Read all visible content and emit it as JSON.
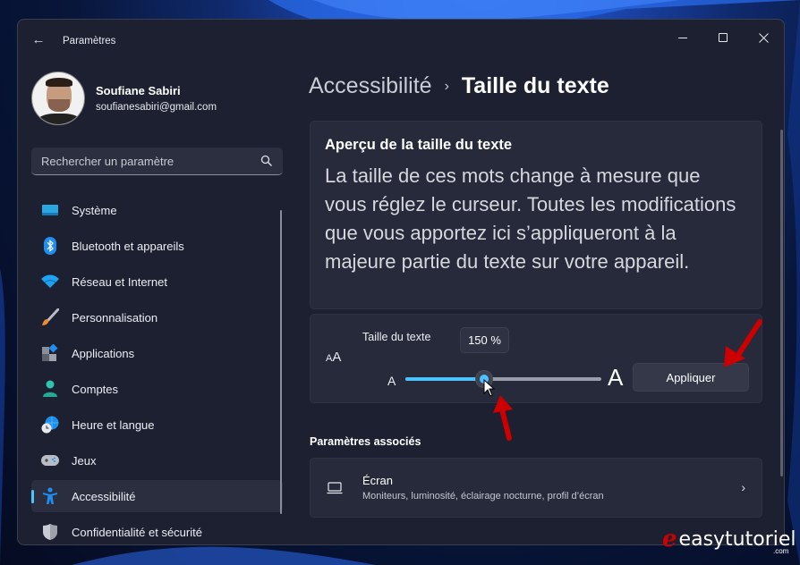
{
  "window": {
    "title": "Paramètres",
    "controls": {
      "minimize": "minimize",
      "maximize": "maximize",
      "close": "close"
    }
  },
  "profile": {
    "name": "Soufiane Sabiri",
    "email": "soufianesabiri@gmail.com"
  },
  "search": {
    "placeholder": "Rechercher un paramètre",
    "value": ""
  },
  "sidebar": {
    "items": [
      {
        "label": "Système",
        "icon": "system-icon",
        "active": false
      },
      {
        "label": "Bluetooth et appareils",
        "icon": "bluetooth-icon",
        "active": false
      },
      {
        "label": "Réseau et Internet",
        "icon": "wifi-icon",
        "active": false
      },
      {
        "label": "Personnalisation",
        "icon": "paintbrush-icon",
        "active": false
      },
      {
        "label": "Applications",
        "icon": "apps-icon",
        "active": false
      },
      {
        "label": "Comptes",
        "icon": "account-icon",
        "active": false
      },
      {
        "label": "Heure et langue",
        "icon": "time-language-icon",
        "active": false
      },
      {
        "label": "Jeux",
        "icon": "gamepad-icon",
        "active": false
      },
      {
        "label": "Accessibilité",
        "icon": "accessibility-icon",
        "active": true
      },
      {
        "label": "Confidentialité et sécurité",
        "icon": "shield-icon",
        "active": false
      }
    ],
    "accent": "#4cc2ff"
  },
  "breadcrumb": {
    "parent": "Accessibilité",
    "separator": "›",
    "current": "Taille du texte"
  },
  "preview": {
    "title": "Aperçu de la taille du texte",
    "text": "La taille de ces mots change à mesure que vous réglez le curseur. Toutes les modifications que vous apportez ici s’appliqueront à la majeure partie du texte sur votre appareil."
  },
  "text_size": {
    "label": "Taille du texte",
    "value_percent": 150,
    "tooltip": "150 %",
    "min_label": "A",
    "max_label": "A",
    "slider_min": 100,
    "slider_max": 225,
    "apply_label": "Appliquer"
  },
  "related": {
    "heading": "Paramètres associés",
    "items": [
      {
        "title": "Écran",
        "subtitle": "Moniteurs, luminosité, éclairage nocturne, profil d’écran"
      }
    ]
  },
  "watermark": {
    "logo": "e",
    "text": "easytutoriel",
    "suffix": ".com"
  },
  "colors": {
    "accent": "#4cc2ff",
    "annotation": "#cc0000"
  }
}
